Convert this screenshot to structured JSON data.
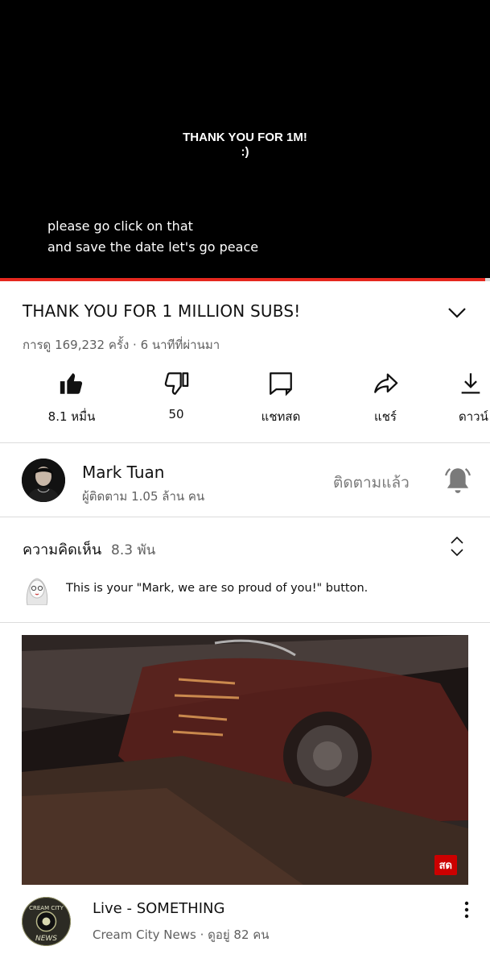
{
  "player": {
    "overlay_title": "THANK YOU FOR 1M!",
    "overlay_smiley": ":)",
    "caption_line1": "please go click on that",
    "caption_line2": "and save the date let's go peace",
    "progress_fraction": 0.99,
    "progress_color": "#e5271e"
  },
  "video": {
    "title": "THANK YOU FOR 1 MILLION SUBS!",
    "meta": "การดู 169,232 ครั้ง · 6 นาทีที่ผ่านมา",
    "expand_icon": "chevron-down-icon"
  },
  "actions": [
    {
      "icon": "thumbs-up-icon",
      "label": "8.1 หมื่น"
    },
    {
      "icon": "thumbs-down-icon",
      "label": "50"
    },
    {
      "icon": "live-chat-icon",
      "label": "แชทสด"
    },
    {
      "icon": "share-icon",
      "label": "แชร์"
    },
    {
      "icon": "download-icon",
      "label": "ดาวน์"
    }
  ],
  "channel": {
    "name": "Mark Tuan",
    "subscribers": "ผู้ติดตาม 1.05 ล้าน คน",
    "subscribed_label": "ติดตามแล้ว",
    "bell_icon": "bell-icon"
  },
  "comments": {
    "label": "ความคิดเห็น",
    "count": "8.3 พัน",
    "sort_icon": "unfold-icon",
    "preview_text": "This is your \"Mark, we are so proud of you!\" button."
  },
  "next_video": {
    "live_badge": "สด",
    "title": "Live - SOMETHING",
    "meta": "Cream City News · ดูอยู่ 82 คน",
    "avatar_text_top": "CREAM CITY",
    "avatar_text_bottom": "NEWS",
    "menu_icon": "more-vert-icon"
  }
}
